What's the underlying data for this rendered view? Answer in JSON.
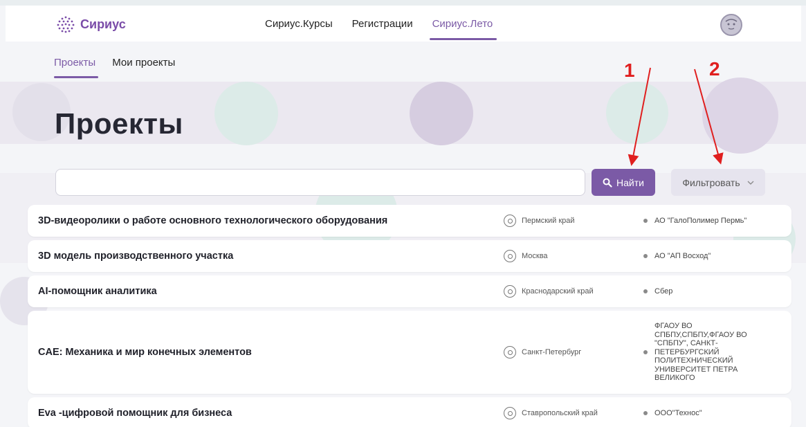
{
  "header": {
    "logo_text": "Сириус",
    "nav": [
      {
        "label": "Сириус.Курсы",
        "active": false
      },
      {
        "label": "Регистрации",
        "active": false
      },
      {
        "label": "Сириус.Лето",
        "active": true
      }
    ]
  },
  "subnav": {
    "items": [
      {
        "label": "Проекты",
        "active": true
      },
      {
        "label": "Мои проекты",
        "active": false
      }
    ]
  },
  "page": {
    "title": "Проекты"
  },
  "search": {
    "value": "",
    "placeholder": "",
    "button_label": "Найти",
    "filter_label": "Фильтровать"
  },
  "annotations": [
    "1",
    "2"
  ],
  "projects": [
    {
      "title": "3D-видеоролики о работе основного технологического оборудования",
      "location": "Пермский край",
      "org": "АО \"ГалоПолимер Пермь\""
    },
    {
      "title": "3D модель производственного участка",
      "location": "Москва",
      "org": "АО \"АП Восход\""
    },
    {
      "title": "AI-помощник аналитика",
      "location": "Краснодарский край",
      "org": "Сбер"
    },
    {
      "title": "CAE: Механика и мир конечных элементов",
      "location": "Санкт-Петербург",
      "org": "ФГАОУ ВО СПБПУ,СПБПУ,ФГАОУ ВО \"СПБПУ\", САНКТ-ПЕТЕРБУРГСКИЙ ПОЛИТЕХНИЧЕСКИЙ УНИВЕРСИТЕТ ПЕТРА ВЕЛИКОГО"
    },
    {
      "title": "Eva -цифровой помощник для бизнеса",
      "location": "Ставропольский край",
      "org": "ООО\"Технос\""
    }
  ],
  "colors": {
    "accent": "#7b5aa6",
    "annotation": "#e01f1f"
  }
}
